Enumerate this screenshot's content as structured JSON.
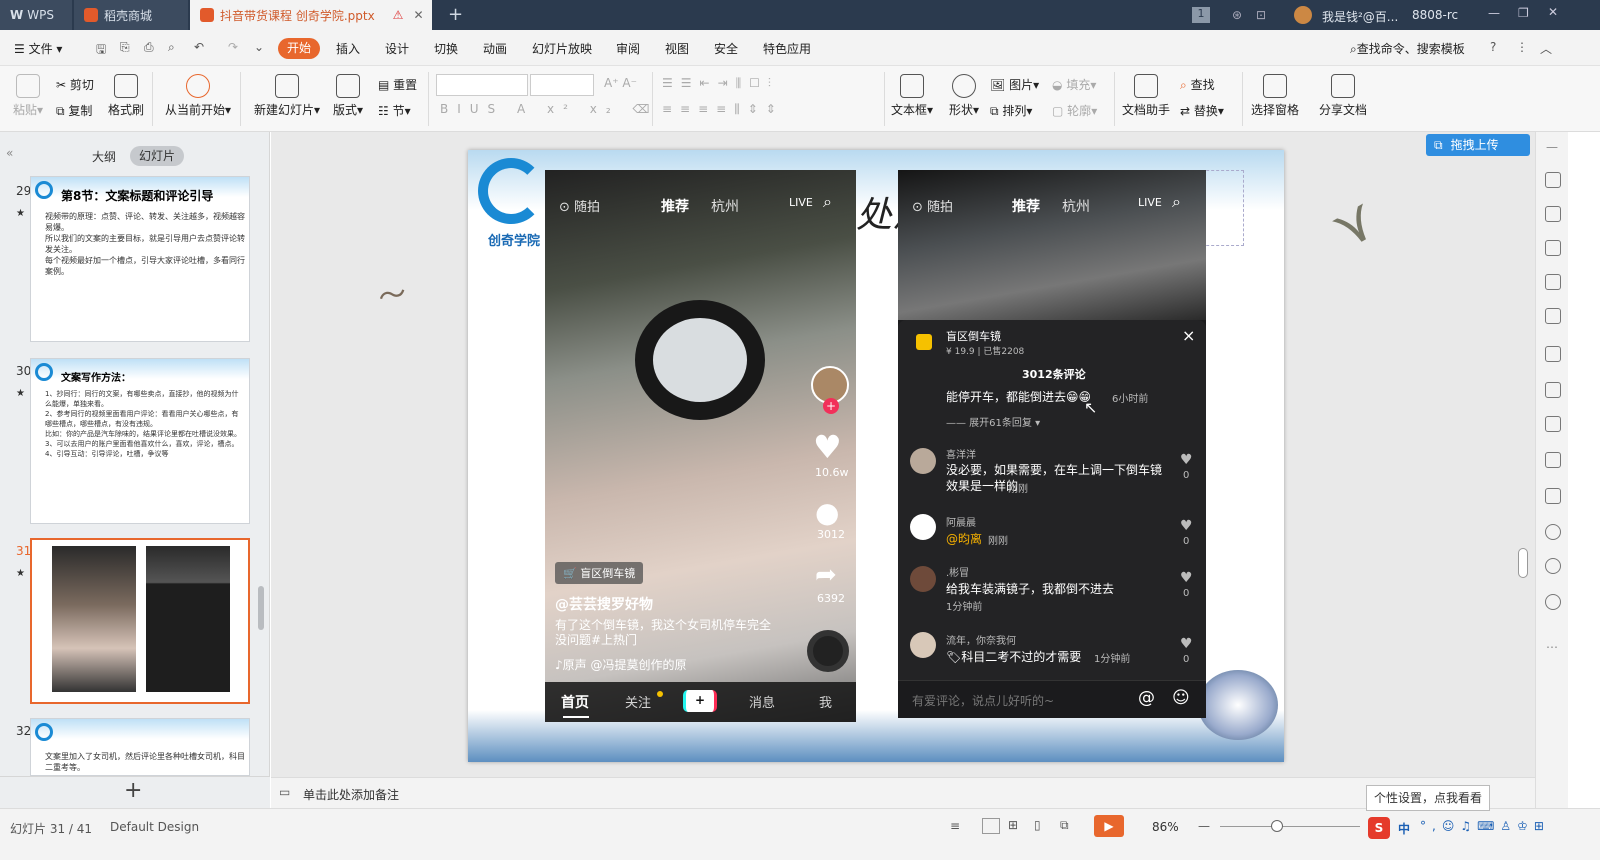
{
  "titlebar": {
    "wps_label": "WPS",
    "tab1": "稻壳商城",
    "tab2": "抖音带货课程  创奇学院.pptx",
    "page_badge": "1",
    "user": "我是钱²@百...",
    "user_extra": "8808-rc"
  },
  "menu": {
    "file": "文件",
    "items": [
      "开始",
      "插入",
      "设计",
      "切换",
      "动画",
      "幻灯片放映",
      "审阅",
      "视图",
      "安全",
      "特色应用"
    ],
    "search": "查找命令、搜索模板"
  },
  "ribbon": {
    "paste": "粘贴",
    "cut": "剪切",
    "copy": "复制",
    "format_painter": "格式刷",
    "from_start": "从当前开始",
    "new_slide": "新建幻灯片",
    "layout": "版式",
    "reset": "重置",
    "section": "节",
    "textbox": "文本框",
    "shape": "形状",
    "picture": "图片",
    "fill": "填充",
    "arrange": "排列",
    "outline": "轮廓",
    "doc_helper": "文档助手",
    "find": "查找",
    "replace": "替换",
    "select_pane": "选择窗格",
    "share": "分享文档"
  },
  "left": {
    "tab_outline": "大纲",
    "tab_slides": "幻灯片",
    "s29": {
      "num": "29",
      "title": "第8节：文案标题和评论引导",
      "lines": [
        "视频带的原理：点赞、评论、转发、关注越多，视频越容易爆。",
        "所以我们的文案的主要目标，就是引导用户去点赞评论转发关注。",
        "每个视频最好加一个槽点，引导大家评论吐槽，多看同行案例。"
      ]
    },
    "s30": {
      "num": "30",
      "title": "文案写作方法：",
      "lines": [
        "1、抄同行：同行的文案，有哪些卖点，直接抄，他的视频为什么能爆，单独来看。",
        "2、参考同行的视频里面看用户评论：看看用户关心哪些点，有哪些槽点，哪些槽点，有没有违规。",
        "比如：你的产品是汽车除味的，结果评论里都在吐槽说没效果。",
        "3、可以去用户的账户里面看他喜欢什么，喜欢，评论，槽点。",
        "4、引导互动：引导评论，吐槽，争议等"
      ]
    },
    "s31": {
      "num": "31"
    },
    "s32": {
      "num": "32",
      "lines": [
        "文案里加入了女司机，然后评论里各种吐槽女司机，科目二重考等。"
      ]
    },
    "add_btn": "+"
  },
  "slide": {
    "logo_text": "创奇学院",
    "title_fragment": "处洋"
  },
  "phone1": {
    "top_tabs": [
      "随拍",
      "推荐",
      "杭州"
    ],
    "shop_tag": "盲区倒车镜",
    "username": "@芸芸搜罗好物",
    "caption": "有了这个倒车镜，我这个女司机停车完全没问题#上热门",
    "music": "♪原声   @冯提莫创作的原",
    "likes": "10.6w",
    "comments": "3012",
    "shares": "6392",
    "nav": [
      "首页",
      "关注",
      "+",
      "消息",
      "我"
    ]
  },
  "phone2": {
    "top_tabs": [
      "随拍",
      "推荐",
      "杭州"
    ],
    "product_name": "盲区倒车镜",
    "product_meta": "¥ 19.9 | 已售2208",
    "comment_count": "3012条评论",
    "pinned": "能停开车，都能倒进去😁😁",
    "pinned_time": "6小时前",
    "expand": "—— 展开61条回复 ▾",
    "comments": [
      {
        "user": "喜洋洋",
        "text": "没必要，如果需要，在车上调一下倒车镜效果是一样的",
        "time": "刚刚",
        "likes": "0"
      },
      {
        "user": "阿晨晨",
        "text": "@昀离",
        "time": "刚刚",
        "likes": "0"
      },
      {
        "user": ".彬冒",
        "text": "给我车装满镜子，我都倒不进去",
        "time": "1分钟前",
        "likes": "0"
      },
      {
        "user": "流年，你奈我何",
        "text": "🏷科目二考不过的才需要",
        "time": "1分钟前",
        "likes": "0"
      }
    ],
    "input_placeholder": "有爱评论，说点儿好听的~",
    "close": "×"
  },
  "upload": "拖拽上传",
  "notes": "单击此处添加备注",
  "status": {
    "slide_info": "幻灯片 31 / 41",
    "design": "Default Design",
    "zoom": "86%",
    "tip": "个性设置，点我看看",
    "ime": "中"
  },
  "colors": {
    "accent": "#e8672d",
    "titlebar": "#2b3a4e",
    "phone_dark": "#1c1c1e"
  }
}
